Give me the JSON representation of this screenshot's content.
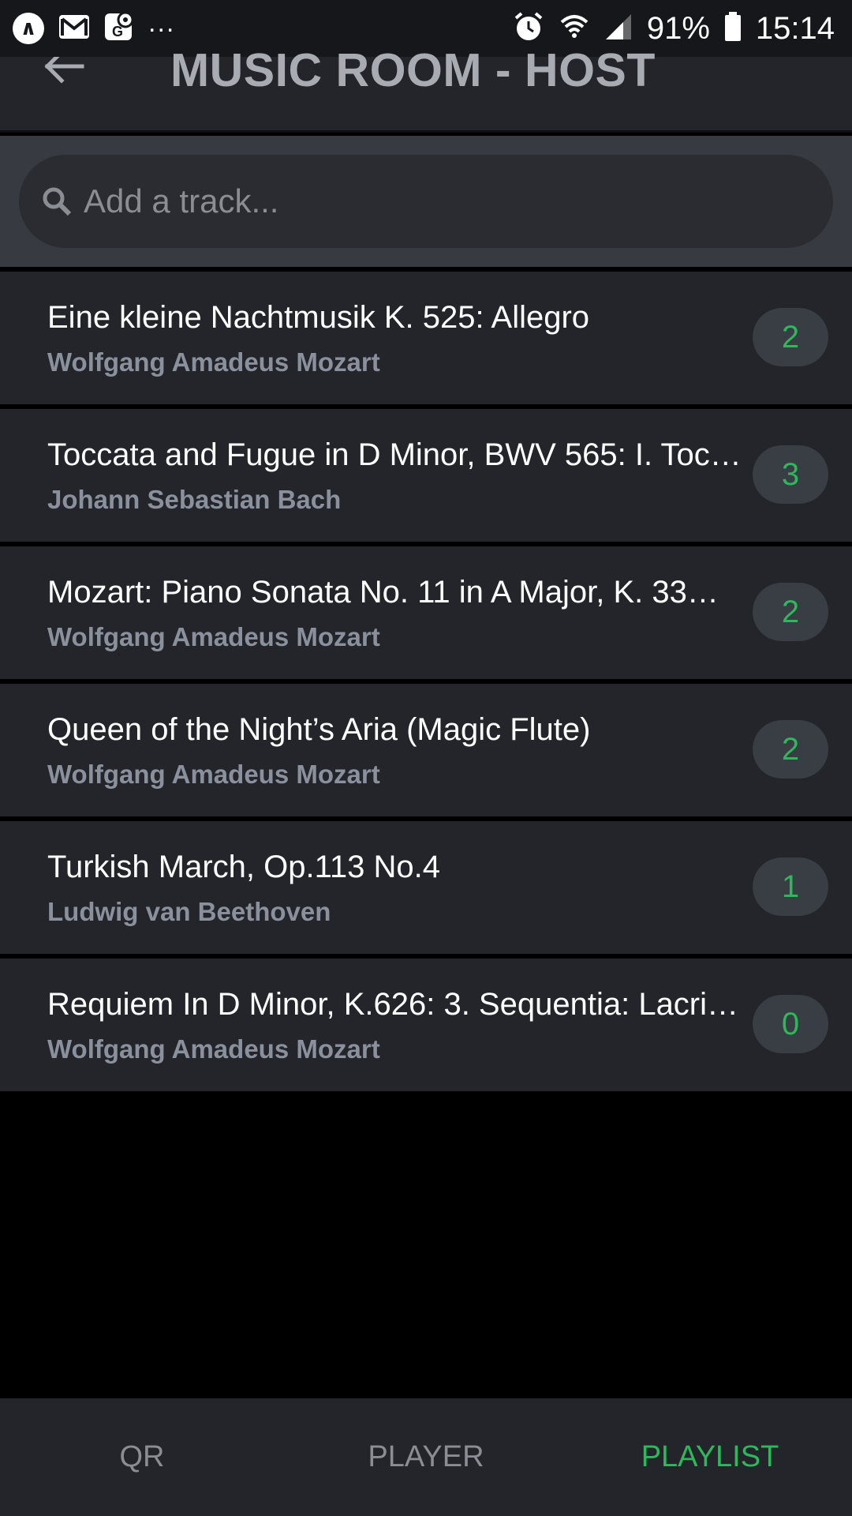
{
  "status_bar": {
    "battery": "91%",
    "time": "15:14",
    "overflow": "..."
  },
  "header": {
    "title": "MUSIC ROOM - HOST"
  },
  "search": {
    "placeholder": "Add a track..."
  },
  "tracks": [
    {
      "title": "Eine kleine Nachtmusik K. 525: Allegro",
      "artist": "Wolfgang Amadeus Mozart",
      "votes": "2"
    },
    {
      "title": "Toccata and Fugue in D Minor, BWV 565: I. Toc…",
      "artist": "Johann Sebastian Bach",
      "votes": "3"
    },
    {
      "title": "Mozart: Piano Sonata No. 11 in A Major, K. 33…",
      "artist": "Wolfgang Amadeus Mozart",
      "votes": "2"
    },
    {
      "title": "Queen of the Night’s Aria (Magic Flute)",
      "artist": "Wolfgang Amadeus Mozart",
      "votes": "2"
    },
    {
      "title": "Turkish March, Op.113 No.4",
      "artist": "Ludwig van Beethoven",
      "votes": "1"
    },
    {
      "title": "Requiem In D Minor, K.626: 3. Sequentia: Lacri…",
      "artist": "Wolfgang Amadeus Mozart",
      "votes": "0"
    }
  ],
  "nav": {
    "tabs": [
      {
        "label": "QR",
        "active": false
      },
      {
        "label": "PLAYER",
        "active": false
      },
      {
        "label": "PLAYLIST",
        "active": true
      }
    ]
  },
  "colors": {
    "accent": "#2fb85b",
    "surface": "#23252b",
    "background": "#000000"
  }
}
